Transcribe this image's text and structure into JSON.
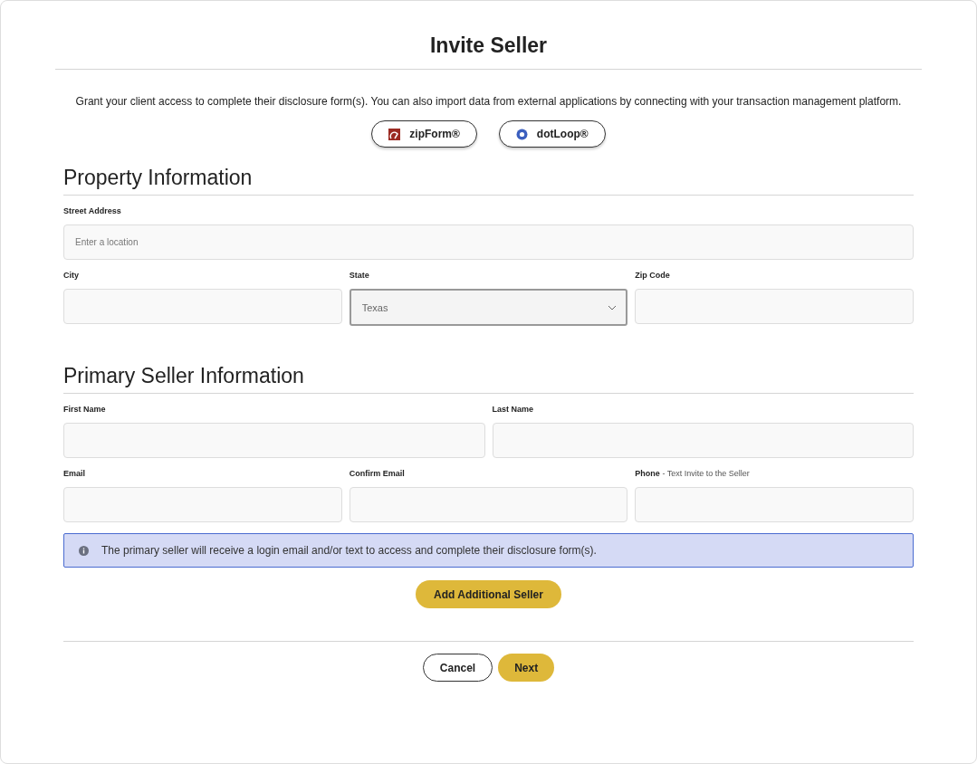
{
  "title": "Invite Seller",
  "intro": "Grant your client access to complete their disclosure form(s). You can also import data from external applications by connecting with your transaction management platform.",
  "integrations": [
    {
      "label": "zipForm®",
      "kind": "zipform"
    },
    {
      "label": "dotLoop®",
      "kind": "dotloop"
    }
  ],
  "sections": [
    {
      "heading": "Property Information",
      "rows": [
        [
          {
            "label": "Street Address",
            "kind": "text",
            "placeholder": "Enter a location"
          }
        ],
        [
          {
            "label": "City",
            "kind": "text"
          },
          {
            "label": "State",
            "kind": "select",
            "value": "Texas"
          },
          {
            "label": "Zip Code",
            "kind": "text"
          }
        ]
      ]
    },
    {
      "heading": "Primary Seller Information",
      "rows": [
        [
          {
            "label": "First Name",
            "kind": "text"
          },
          {
            "label": "Last Name",
            "kind": "text"
          }
        ],
        [
          {
            "label": "Email",
            "kind": "text"
          },
          {
            "label": "Confirm Email",
            "kind": "text"
          },
          {
            "label": "Phone",
            "hint": "- Text Invite to the Seller",
            "kind": "text"
          }
        ]
      ]
    }
  ],
  "notice": "The primary seller will receive a login email and/or text to access and complete their disclosure form(s).",
  "add_button": "Add Additional Seller",
  "buttons": [
    {
      "label": "Cancel",
      "kind": "secondary"
    },
    {
      "label": "Next",
      "kind": "primary"
    }
  ]
}
